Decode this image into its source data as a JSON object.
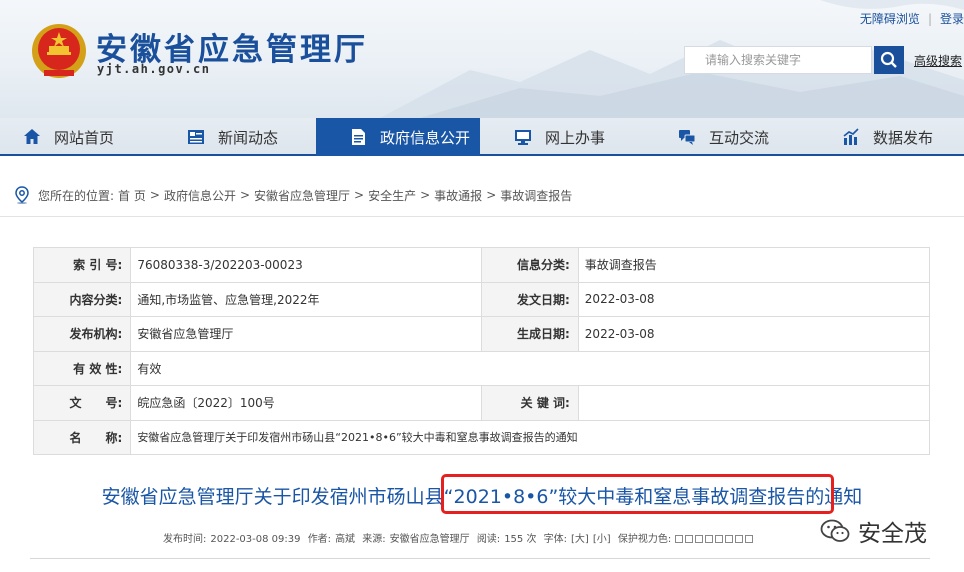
{
  "header": {
    "site_title": "安徽省应急管理厅",
    "site_url": "yjt.ah.gov.cn",
    "accessibility_link": "无障碍浏览",
    "login_link": "登录",
    "search_placeholder": "请输入搜索关键字",
    "advanced_search": "高级搜索"
  },
  "nav": {
    "items": [
      {
        "label": "网站首页",
        "icon": "home-icon"
      },
      {
        "label": "新闻动态",
        "icon": "news-icon"
      },
      {
        "label": "政府信息公开",
        "icon": "document-icon",
        "active": true
      },
      {
        "label": "网上办事",
        "icon": "monitor-icon"
      },
      {
        "label": "互动交流",
        "icon": "chat-icon"
      },
      {
        "label": "数据发布",
        "icon": "chart-icon"
      }
    ],
    "active_color": "#1a56a6"
  },
  "breadcrumb": {
    "prefix": "您所在的位置:",
    "items": [
      "首 页",
      ">",
      "政府信息公开",
      ">",
      "安徽省应急管理厅",
      ">",
      "安全生产",
      ">",
      "事故通报",
      ">",
      "事故调查报告"
    ]
  },
  "meta": {
    "index_label": "索 引 号:",
    "index_value": "76080338-3/202203-00023",
    "category_label": "信息分类:",
    "category_value": "事故调查报告",
    "content_label": "内容分类:",
    "content_value": "通知,市场监管、应急管理,2022年",
    "issue_date_label": "发文日期:",
    "issue_date_value": "2022-03-08",
    "org_label": "发布机构:",
    "org_value": "安徽省应急管理厅",
    "effective_date_label": "生成日期:",
    "effective_date_value": "2022-03-08",
    "validity_label": "有 效 性:",
    "validity_value": "有效",
    "doc_no_label": "文　　号:",
    "doc_no_value": "皖应急函〔2022〕100号",
    "keywords_label": "关 键 词:",
    "keywords_value": "",
    "name_label": "名　　称:",
    "name_value": "安徽省应急管理厅关于印发宿州市砀山县“2021•8•6”较大中毒和窒息事故调查报告的通知"
  },
  "article": {
    "title": "安徽省应急管理厅关于印发宿州市砀山县“2021•8•6”较大中毒和窒息事故调查报告的通知",
    "highlight_color": "#e6201e",
    "publish_time_label": "发布时间:",
    "publish_time": "2022-03-08 09:39",
    "author_label": "作者:",
    "author": "高斌",
    "source_label": "来源:",
    "source": "安徽省应急管理厅",
    "reads_label": "阅读:",
    "reads": "155 次",
    "font_label": "字体:",
    "font_large": "[大]",
    "font_small": "[小]",
    "eye_color_label": "保护视力色:"
  },
  "watermark": {
    "text": "安全茂"
  }
}
